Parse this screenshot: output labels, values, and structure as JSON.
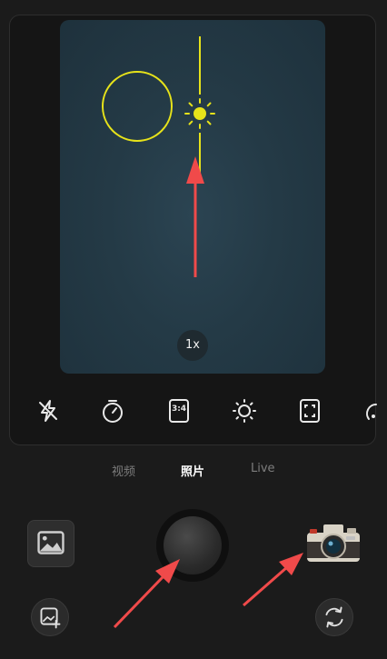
{
  "viewfinder": {
    "zoom_label": "1x"
  },
  "toolbar": {
    "items": [
      "flash-off-icon",
      "timer-icon",
      "aspect-ratio-icon",
      "brightness-icon",
      "frame-icon",
      "more-icon"
    ],
    "aspect_label": "3:4"
  },
  "modes": [
    {
      "label": "视频",
      "active": false
    },
    {
      "label": "照片",
      "active": true
    },
    {
      "label": "Live",
      "active": false
    }
  ],
  "colors": {
    "focus_yellow": "#e7e31a",
    "annotation_red": "#f04a4a"
  }
}
